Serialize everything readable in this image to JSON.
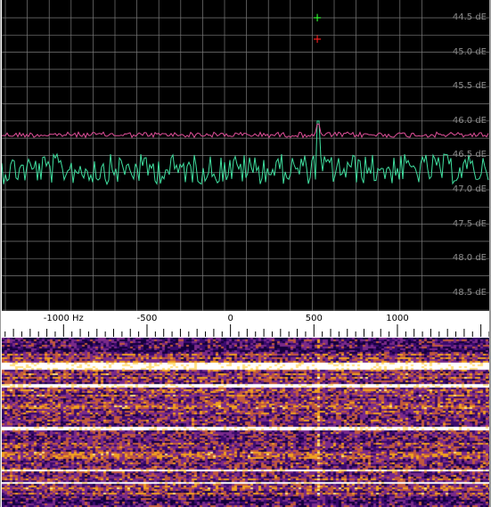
{
  "spectrum": {
    "db_labels": [
      "44.5 dE",
      "45.0 dE",
      "45.5 dE",
      "46.0 dE",
      "46.5 dE",
      "47.0 dE",
      "47.5 dE",
      "48.0 dE",
      "48.5 dE"
    ],
    "db_values": [
      -44.5,
      -45.0,
      -45.5,
      -46.0,
      -46.5,
      -47.0,
      -47.5,
      -48.0,
      -48.5
    ],
    "peak_marker_green": "+",
    "peak_marker_red": "+",
    "trace_colors": {
      "average": "#e0509a",
      "current": "#40e0a0",
      "grid": "#7a7a7a",
      "background": "#000000"
    },
    "traces": {
      "average_level_db": -46.2,
      "current_level_db": -46.7,
      "signal_hz": 520,
      "signal_peak_db": -46.0
    }
  },
  "scale": {
    "hz_labels": [
      {
        "text": "-1000 Hz",
        "hz": -1000
      },
      {
        "text": "-500",
        "hz": -500
      },
      {
        "text": "0",
        "hz": 0
      },
      {
        "text": "500",
        "hz": 500
      },
      {
        "text": "1000",
        "hz": 1000
      }
    ],
    "span_hz": [
      -1370,
      1550
    ]
  },
  "waterfall": {
    "palette": [
      "#14003c",
      "#3a0a6e",
      "#7a2a8a",
      "#c25a3c",
      "#f0a020",
      "#ffe080",
      "#ffffff"
    ],
    "signal_hz": 520
  }
}
